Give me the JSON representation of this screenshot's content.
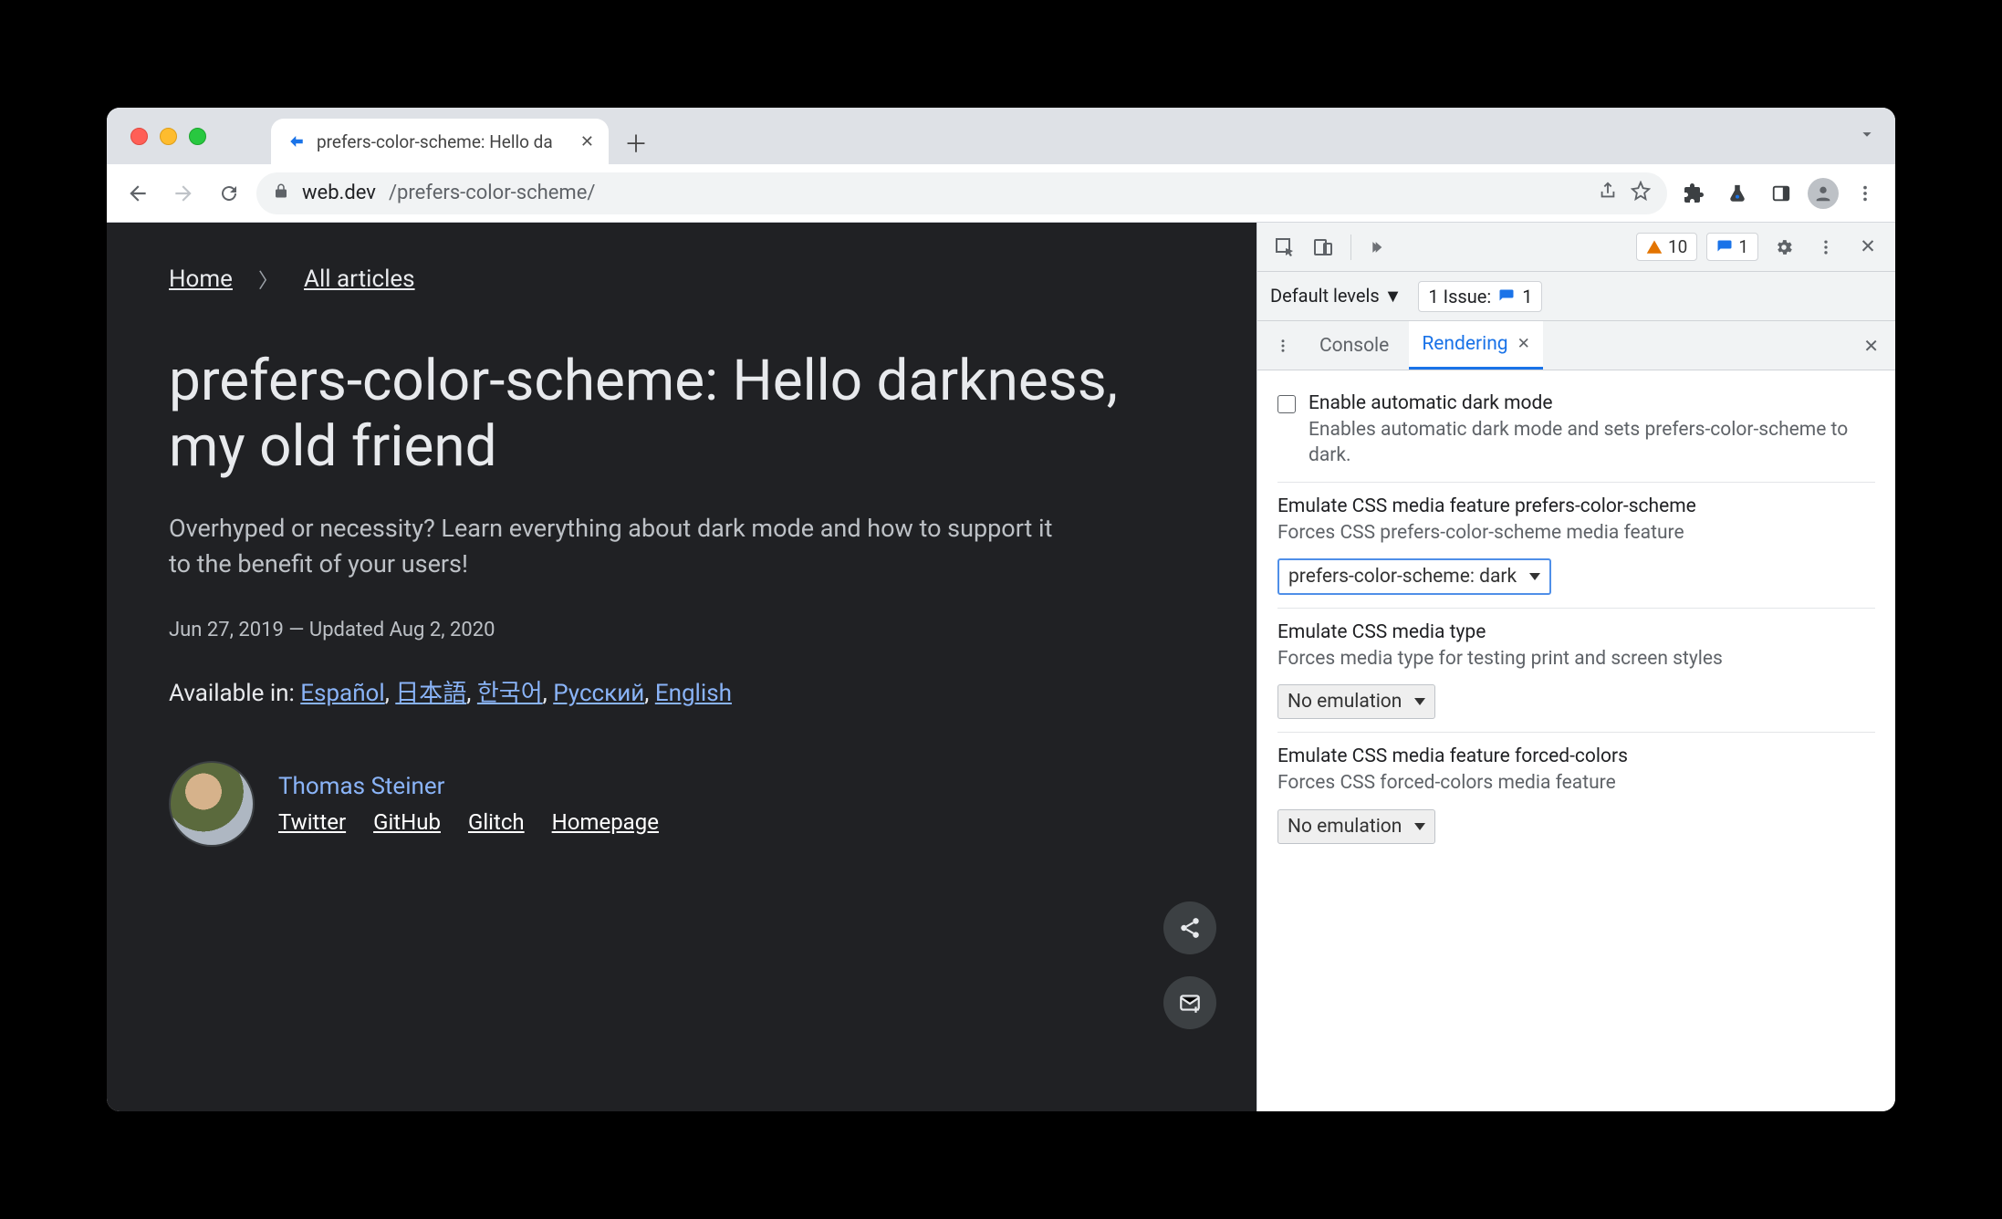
{
  "tabstrip": {
    "tab_title": "prefers-color-scheme: Hello da",
    "favicon_glyph": "≥"
  },
  "omnibox": {
    "domain": "web.dev",
    "path": "/prefers-color-scheme/"
  },
  "page": {
    "breadcrumb": {
      "home": "Home",
      "all_articles": "All articles"
    },
    "title": "prefers-color-scheme: Hello darkness, my old friend",
    "subhead": "Overhyped or necessity? Learn everything about dark mode and how to support it to the benefit of your users!",
    "dates": "Jun 27, 2019 — Updated Aug 2, 2020",
    "langs_label": "Available in:",
    "langs": {
      "es": "Español",
      "ja": "日本語",
      "ko": "한국어",
      "ru": "Русский",
      "en": "English"
    },
    "author": {
      "name": "Thomas Steiner",
      "links": {
        "twitter": "Twitter",
        "github": "GitHub",
        "glitch": "Glitch",
        "homepage": "Homepage"
      }
    }
  },
  "devtools": {
    "warn_count": "10",
    "info_count": "1",
    "levels_label": "Default levels",
    "issues_label": "1 Issue:",
    "issues_count": "1",
    "drawer_tabs": {
      "console": "Console",
      "rendering": "Rendering"
    },
    "rendering": {
      "dark_mode": {
        "title": "Enable automatic dark mode",
        "desc": "Enables automatic dark mode and sets prefers-color-scheme to dark."
      },
      "pcs": {
        "title": "Emulate CSS media feature prefers-color-scheme",
        "desc": "Forces CSS prefers-color-scheme media feature",
        "value": "prefers-color-scheme: dark"
      },
      "media_type": {
        "title": "Emulate CSS media type",
        "desc": "Forces media type for testing print and screen styles",
        "value": "No emulation"
      },
      "forced_colors": {
        "title": "Emulate CSS media feature forced-colors",
        "desc": "Forces CSS forced-colors media feature",
        "value": "No emulation"
      }
    }
  }
}
